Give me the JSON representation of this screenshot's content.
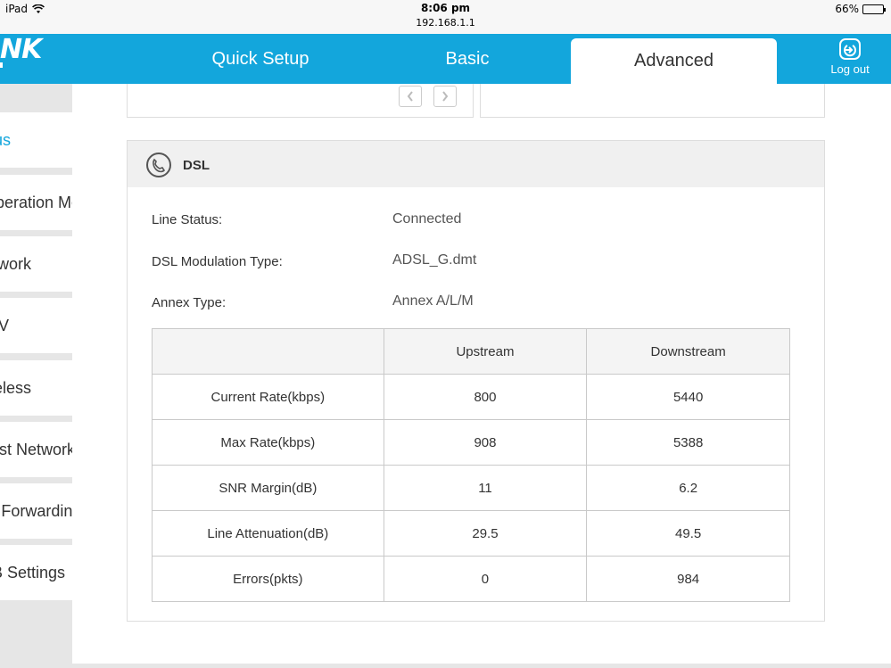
{
  "statusbar": {
    "device": "iPad",
    "time": "8:06 pm",
    "url": "192.168.1.1",
    "battery": "66%",
    "battery_level": 0.66
  },
  "header": {
    "logo": "NK",
    "tabs": [
      {
        "label": "Quick Setup"
      },
      {
        "label": "Basic"
      },
      {
        "label": "Advanced"
      }
    ],
    "logout_label": "Log out"
  },
  "sidebar": {
    "items": [
      {
        "label": "Status"
      },
      {
        "label": "Operation Mode"
      },
      {
        "label": "Network"
      },
      {
        "label": "IPTV"
      },
      {
        "label": "Wireless"
      },
      {
        "label": "Guest Network"
      },
      {
        "label": "NAT Forwarding"
      },
      {
        "label": "USB Settings"
      }
    ]
  },
  "dsl": {
    "title": "DSL",
    "line_status_label": "Line Status:",
    "line_status_value": "Connected",
    "modulation_label": "DSL Modulation Type:",
    "modulation_value": "ADSL_G.dmt",
    "annex_label": "Annex Type:",
    "annex_value": "Annex A/L/M",
    "table": {
      "headers": [
        "",
        "Upstream",
        "Downstream"
      ],
      "rows": [
        [
          "Current Rate(kbps)",
          "800",
          "5440"
        ],
        [
          "Max Rate(kbps)",
          "908",
          "5388"
        ],
        [
          "SNR Margin(dB)",
          "11",
          "6.2"
        ],
        [
          "Line Attenuation(dB)",
          "29.5",
          "49.5"
        ],
        [
          "Errors(pkts)",
          "0",
          "984"
        ]
      ]
    }
  }
}
